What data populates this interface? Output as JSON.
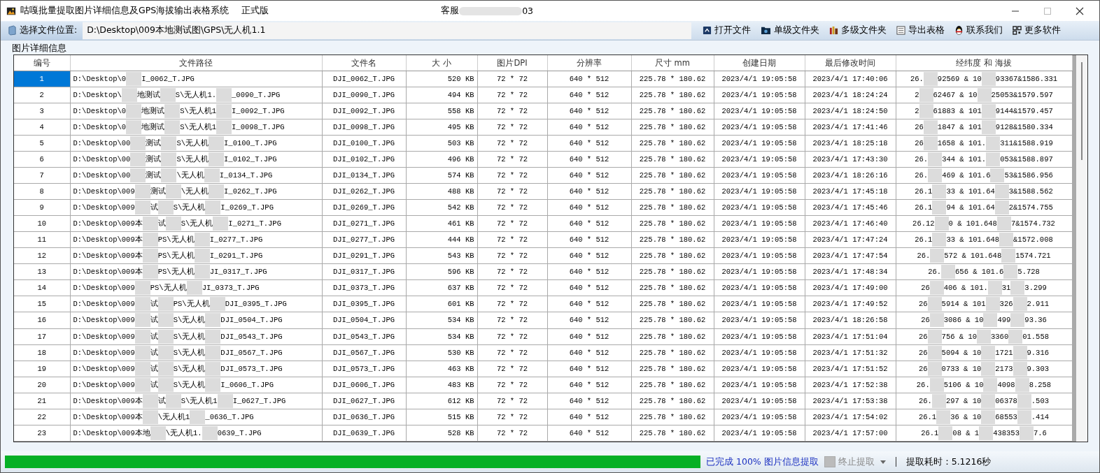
{
  "window": {
    "title": "咕嘎批量提取图片详细信息及GPS海拔输出表格系统",
    "edition": "正式版",
    "service": [
      "客服",
      "03"
    ]
  },
  "toolbar": {
    "location_button": "选择文件位置:",
    "path": "D:\\Desktop\\009本地测试图\\GPS\\无人机1.1",
    "actions": [
      {
        "label": "打开文件"
      },
      {
        "label": "单级文件夹"
      },
      {
        "label": "多级文件夹"
      },
      {
        "label": "导出表格"
      },
      {
        "label": "联系我们"
      },
      {
        "label": "更多软件"
      }
    ]
  },
  "group_title": "图片详细信息",
  "table": {
    "columns": [
      "编号",
      "文件路径",
      "文件名",
      "大 小",
      "图片DPI",
      "分辨率",
      "尺寸 mm",
      "创建日期",
      "最后修改时间",
      "经纬度 和 海拔"
    ],
    "rows": [
      {
        "no": "1",
        "selected": true,
        "path": [
          "D:\\Desktop\\0",
          "I_0062_T.JPG"
        ],
        "file": "DJI_0062_T.JPG",
        "size": "520 KB",
        "dpi": "72 * 72",
        "resolution": "640 * 512",
        "dimensions": "225.78 * 180.62",
        "created": "2023/4/1 19:05:58",
        "modified": "2023/4/1 17:40:06",
        "gps": [
          "26.",
          "92569 & 10",
          "93367&1586.331"
        ]
      },
      {
        "no": "2",
        "selected": false,
        "path": [
          "D:\\Desktop\\",
          "地测试",
          "S\\无人机1.",
          "_0090_T.JPG"
        ],
        "file": "DJI_0090_T.JPG",
        "size": "494 KB",
        "dpi": "72 * 72",
        "resolution": "640 * 512",
        "dimensions": "225.78 * 180.62",
        "created": "2023/4/1 19:05:58",
        "modified": "2023/4/1 18:24:24",
        "gps": [
          "2",
          "62467 & 10",
          "25053&1579.597"
        ]
      },
      {
        "no": "3",
        "selected": false,
        "path": [
          "D:\\Desktop\\0",
          "地测试",
          "S\\无人机1",
          "I_0092_T.JPG"
        ],
        "file": "DJI_0092_T.JPG",
        "size": "558 KB",
        "dpi": "72 * 72",
        "resolution": "640 * 512",
        "dimensions": "225.78 * 180.62",
        "created": "2023/4/1 19:05:58",
        "modified": "2023/4/1 18:24:50",
        "gps": [
          "2",
          "61883 & 101",
          "9144&1579.457"
        ]
      },
      {
        "no": "4",
        "selected": false,
        "path": [
          "D:\\Desktop\\0",
          "地测试",
          "S\\无人机1",
          "I_0098_T.JPG"
        ],
        "file": "DJI_0098_T.JPG",
        "size": "495 KB",
        "dpi": "72 * 72",
        "resolution": "640 * 512",
        "dimensions": "225.78 * 180.62",
        "created": "2023/4/1 19:05:58",
        "modified": "2023/4/1 17:41:46",
        "gps": [
          "26",
          "1847 & 101",
          "9128&1580.334"
        ]
      },
      {
        "no": "5",
        "selected": false,
        "path": [
          "D:\\Desktop\\00",
          "测试",
          "S\\无人机",
          "I_0100_T.JPG"
        ],
        "file": "DJI_0100_T.JPG",
        "size": "503 KB",
        "dpi": "72 * 72",
        "resolution": "640 * 512",
        "dimensions": "225.78 * 180.62",
        "created": "2023/4/1 19:05:58",
        "modified": "2023/4/1 18:25:18",
        "gps": [
          "26",
          "1658 & 101.",
          "311&1588.919"
        ]
      },
      {
        "no": "6",
        "selected": false,
        "path": [
          "D:\\Desktop\\00",
          "测试",
          "S\\无人机",
          "I_0102_T.JPG"
        ],
        "file": "DJI_0102_T.JPG",
        "size": "496 KB",
        "dpi": "72 * 72",
        "resolution": "640 * 512",
        "dimensions": "225.78 * 180.62",
        "created": "2023/4/1 19:05:58",
        "modified": "2023/4/1 17:43:30",
        "gps": [
          "26.",
          "344 & 101.",
          "053&1588.897"
        ]
      },
      {
        "no": "7",
        "selected": false,
        "path": [
          "D:\\Desktop\\00",
          "测试",
          "\\无人机",
          "I_0134_T.JPG"
        ],
        "file": "DJI_0134_T.JPG",
        "size": "574 KB",
        "dpi": "72 * 72",
        "resolution": "640 * 512",
        "dimensions": "225.78 * 180.62",
        "created": "2023/4/1 19:05:58",
        "modified": "2023/4/1 18:26:16",
        "gps": [
          "26.",
          "469 & 101.6",
          "53&1586.956"
        ]
      },
      {
        "no": "8",
        "selected": false,
        "path": [
          "D:\\Desktop\\009",
          "测试",
          "\\无人机",
          "I_0262_T.JPG"
        ],
        "file": "DJI_0262_T.JPG",
        "size": "488 KB",
        "dpi": "72 * 72",
        "resolution": "640 * 512",
        "dimensions": "225.78 * 180.62",
        "created": "2023/4/1 19:05:58",
        "modified": "2023/4/1 17:45:18",
        "gps": [
          "26.1",
          "33 & 101.64",
          "3&1588.562"
        ]
      },
      {
        "no": "9",
        "selected": false,
        "path": [
          "D:\\Desktop\\009",
          "试",
          "S\\无人机",
          "I_0269_T.JPG"
        ],
        "file": "DJI_0269_T.JPG",
        "size": "542 KB",
        "dpi": "72 * 72",
        "resolution": "640 * 512",
        "dimensions": "225.78 * 180.62",
        "created": "2023/4/1 19:05:58",
        "modified": "2023/4/1 17:45:46",
        "gps": [
          "26.1",
          "94 & 101.64",
          "2&1574.755"
        ]
      },
      {
        "no": "10",
        "selected": false,
        "path": [
          "D:\\Desktop\\009本",
          "试",
          "S\\无人机",
          "I_0271_T.JPG"
        ],
        "file": "DJI_0271_T.JPG",
        "size": "461 KB",
        "dpi": "72 * 72",
        "resolution": "640 * 512",
        "dimensions": "225.78 * 180.62",
        "created": "2023/4/1 19:05:58",
        "modified": "2023/4/1 17:46:40",
        "gps": [
          "26.12",
          "0 & 101.648",
          "7&1574.732"
        ]
      },
      {
        "no": "11",
        "selected": false,
        "path": [
          "D:\\Desktop\\009本",
          "PS\\无人机",
          "I_0277_T.JPG"
        ],
        "file": "DJI_0277_T.JPG",
        "size": "444 KB",
        "dpi": "72 * 72",
        "resolution": "640 * 512",
        "dimensions": "225.78 * 180.62",
        "created": "2023/4/1 19:05:58",
        "modified": "2023/4/1 17:47:24",
        "gps": [
          "26.1",
          "33 & 101.648",
          "&1572.008"
        ]
      },
      {
        "no": "12",
        "selected": false,
        "path": [
          "D:\\Desktop\\009本",
          "PS\\无人机",
          "I_0291_T.JPG"
        ],
        "file": "DJI_0291_T.JPG",
        "size": "543 KB",
        "dpi": "72 * 72",
        "resolution": "640 * 512",
        "dimensions": "225.78 * 180.62",
        "created": "2023/4/1 19:05:58",
        "modified": "2023/4/1 17:47:54",
        "gps": [
          "26.",
          "572 & 101.648",
          "1574.721"
        ]
      },
      {
        "no": "13",
        "selected": false,
        "path": [
          "D:\\Desktop\\009本",
          "PS\\无人机",
          "JI_0317_T.JPG"
        ],
        "file": "DJI_0317_T.JPG",
        "size": "596 KB",
        "dpi": "72 * 72",
        "resolution": "640 * 512",
        "dimensions": "225.78 * 180.62",
        "created": "2023/4/1 19:05:58",
        "modified": "2023/4/1 17:48:34",
        "gps": [
          "26.",
          "656 & 101.6",
          "5.728"
        ]
      },
      {
        "no": "14",
        "selected": false,
        "path": [
          "D:\\Desktop\\009",
          "PS\\无人机",
          "JI_0373_T.JPG"
        ],
        "file": "DJI_0373_T.JPG",
        "size": "637 KB",
        "dpi": "72 * 72",
        "resolution": "640 * 512",
        "dimensions": "225.78 * 180.62",
        "created": "2023/4/1 19:05:58",
        "modified": "2023/4/1 17:49:00",
        "gps": [
          "26",
          "406 & 101.",
          "31",
          "3.299"
        ]
      },
      {
        "no": "15",
        "selected": false,
        "path": [
          "D:\\Desktop\\009",
          "试",
          "PS\\无人机",
          "DJI_0395_T.JPG"
        ],
        "file": "DJI_0395_T.JPG",
        "size": "601 KB",
        "dpi": "72 * 72",
        "resolution": "640 * 512",
        "dimensions": "225.78 * 180.62",
        "created": "2023/4/1 19:05:58",
        "modified": "2023/4/1 17:49:52",
        "gps": [
          "26",
          "5914 & 101",
          "326",
          "2.911"
        ]
      },
      {
        "no": "16",
        "selected": false,
        "path": [
          "D:\\Desktop\\009",
          "试",
          "S\\无人机",
          "DJI_0504_T.JPG"
        ],
        "file": "DJI_0504_T.JPG",
        "size": "534 KB",
        "dpi": "72 * 72",
        "resolution": "640 * 512",
        "dimensions": "225.78 * 180.62",
        "created": "2023/4/1 19:05:58",
        "modified": "2023/4/1 18:26:58",
        "gps": [
          "26",
          "3086 & 10",
          "499",
          "93.36"
        ]
      },
      {
        "no": "17",
        "selected": false,
        "path": [
          "D:\\Desktop\\009",
          "试",
          "S\\无人机",
          "DJI_0543_T.JPG"
        ],
        "file": "DJI_0543_T.JPG",
        "size": "534 KB",
        "dpi": "72 * 72",
        "resolution": "640 * 512",
        "dimensions": "225.78 * 180.62",
        "created": "2023/4/1 19:05:58",
        "modified": "2023/4/1 17:51:04",
        "gps": [
          "26",
          "756 & 10",
          "3360",
          "01.558"
        ]
      },
      {
        "no": "18",
        "selected": false,
        "path": [
          "D:\\Desktop\\009",
          "试",
          "S\\无人机",
          "DJI_0567_T.JPG"
        ],
        "file": "DJI_0567_T.JPG",
        "size": "530 KB",
        "dpi": "72 * 72",
        "resolution": "640 * 512",
        "dimensions": "225.78 * 180.62",
        "created": "2023/4/1 19:05:58",
        "modified": "2023/4/1 17:51:32",
        "gps": [
          "26",
          "5094 & 10",
          "1721",
          "9.316"
        ]
      },
      {
        "no": "19",
        "selected": false,
        "path": [
          "D:\\Desktop\\009",
          "试",
          "S\\无人机",
          "DJI_0573_T.JPG"
        ],
        "file": "DJI_0573_T.JPG",
        "size": "463 KB",
        "dpi": "72 * 72",
        "resolution": "640 * 512",
        "dimensions": "225.78 * 180.62",
        "created": "2023/4/1 19:05:58",
        "modified": "2023/4/1 17:51:52",
        "gps": [
          "26",
          "0733 & 10",
          "2173",
          "9.303"
        ]
      },
      {
        "no": "20",
        "selected": false,
        "path": [
          "D:\\Desktop\\009",
          "试",
          "S\\无人机",
          "I_0606_T.JPG"
        ],
        "file": "DJI_0606_T.JPG",
        "size": "483 KB",
        "dpi": "72 * 72",
        "resolution": "640 * 512",
        "dimensions": "225.78 * 180.62",
        "created": "2023/4/1 19:05:58",
        "modified": "2023/4/1 17:52:38",
        "gps": [
          "26.",
          "5106 & 10",
          "4098",
          "8.258"
        ]
      },
      {
        "no": "21",
        "selected": false,
        "path": [
          "D:\\Desktop\\009本",
          "试",
          "S\\无人机1",
          "I_0627_T.JPG"
        ],
        "file": "DJI_0627_T.JPG",
        "size": "612 KB",
        "dpi": "72 * 72",
        "resolution": "640 * 512",
        "dimensions": "225.78 * 180.62",
        "created": "2023/4/1 19:05:58",
        "modified": "2023/4/1 17:53:38",
        "gps": [
          "26.",
          "297 & 10",
          "06378",
          ".503"
        ]
      },
      {
        "no": "22",
        "selected": false,
        "path": [
          "D:\\Desktop\\009本",
          "\\无人机1",
          "_0636_T.JPG"
        ],
        "file": "DJI_0636_T.JPG",
        "size": "515 KB",
        "dpi": "72 * 72",
        "resolution": "640 * 512",
        "dimensions": "225.78 * 180.62",
        "created": "2023/4/1 19:05:58",
        "modified": "2023/4/1 17:54:02",
        "gps": [
          "26.1",
          "36 & 10",
          "68553",
          ".414"
        ]
      },
      {
        "no": "23",
        "selected": false,
        "path": [
          "D:\\Desktop\\009本地",
          "\\无人机1.",
          "0639_T.JPG"
        ],
        "file": "DJI_0639_T.JPG",
        "size": "528 KB",
        "dpi": "72 * 72",
        "resolution": "640 * 512",
        "dimensions": "225.78 * 180.62",
        "created": "2023/4/1 19:05:58",
        "modified": "2023/4/1 17:57:00",
        "gps": [
          "26.1",
          "08 & 1",
          "438353",
          "7.6"
        ]
      }
    ]
  },
  "status_bar": {
    "progress": {
      "level": 1
    },
    "message": "已完成 100% 图片信息提取",
    "stop": {
      "label": "终止提取",
      "disabled": true
    },
    "elapsed": "提取耗时：5.1216秒"
  }
}
